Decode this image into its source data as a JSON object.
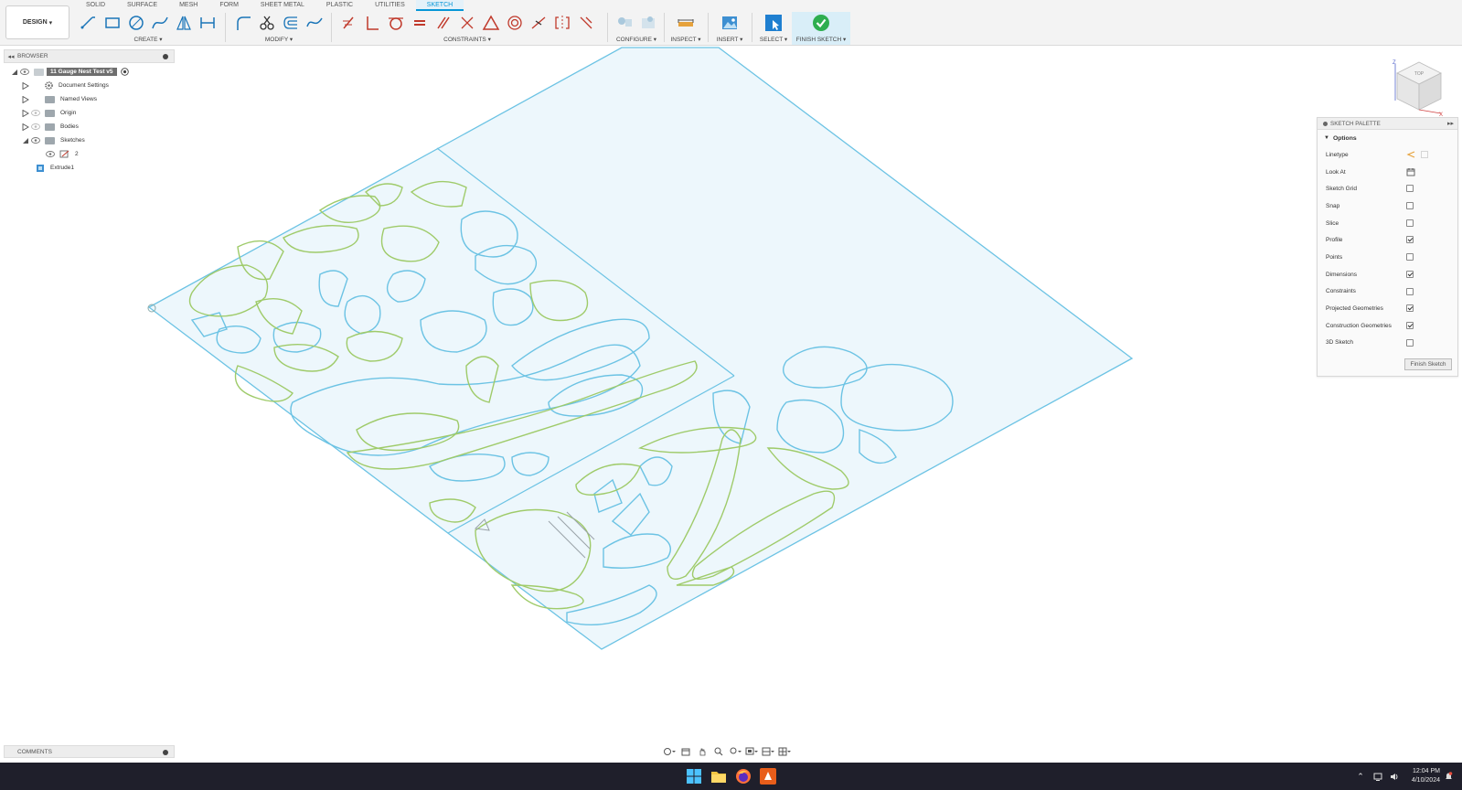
{
  "workspace": {
    "label": "DESIGN"
  },
  "tabs": [
    {
      "label": "SOLID",
      "active": false
    },
    {
      "label": "SURFACE",
      "active": false
    },
    {
      "label": "MESH",
      "active": false
    },
    {
      "label": "FORM",
      "active": false
    },
    {
      "label": "SHEET METAL",
      "active": false
    },
    {
      "label": "PLASTIC",
      "active": false
    },
    {
      "label": "UTILITIES",
      "active": false
    },
    {
      "label": "SKETCH",
      "active": true
    }
  ],
  "groups": {
    "create": "CREATE ▾",
    "modify": "MODIFY ▾",
    "constraints": "CONSTRAINTS ▾",
    "configure": "CONFIGURE ▾",
    "inspect": "INSPECT ▾",
    "insert": "INSERT ▾",
    "select": "SELECT ▾",
    "finish": "FINISH SKETCH ▾"
  },
  "browser": {
    "title": "BROWSER",
    "root": "11 Gauge Nest Test v5",
    "items": [
      {
        "label": "Document Settings"
      },
      {
        "label": "Named Views"
      },
      {
        "label": "Origin"
      },
      {
        "label": "Bodies"
      },
      {
        "label": "Sketches"
      },
      {
        "label": "2"
      },
      {
        "label": "Extrude1"
      }
    ]
  },
  "palette": {
    "title": "SKETCH PALETTE",
    "section": "Options",
    "rows": [
      {
        "label": "Linetype",
        "kind": "linetype"
      },
      {
        "label": "Look At",
        "kind": "lookat"
      },
      {
        "label": "Sketch Grid",
        "kind": "check",
        "checked": false
      },
      {
        "label": "Snap",
        "kind": "check",
        "checked": false
      },
      {
        "label": "Slice",
        "kind": "check",
        "checked": false
      },
      {
        "label": "Profile",
        "kind": "check",
        "checked": true
      },
      {
        "label": "Points",
        "kind": "check",
        "checked": false
      },
      {
        "label": "Dimensions",
        "kind": "check",
        "checked": true
      },
      {
        "label": "Constraints",
        "kind": "check",
        "checked": false
      },
      {
        "label": "Projected Geometries",
        "kind": "check",
        "checked": true
      },
      {
        "label": "Construction Geometries",
        "kind": "check",
        "checked": true
      },
      {
        "label": "3D Sketch",
        "kind": "check",
        "checked": false
      }
    ],
    "finish_label": "Finish Sketch"
  },
  "comments": {
    "title": "COMMENTS"
  },
  "viewcube": {
    "face": "TOP",
    "axis_z": "Z",
    "axis_x": "X"
  },
  "clock": {
    "time": "12:04 PM",
    "date": "4/10/2024"
  },
  "colors": {
    "accent": "#0696d7",
    "sketch_blue": "#6cc3e4",
    "profile_green": "#9fcb6a",
    "plate_fill": "#edf7fc"
  }
}
